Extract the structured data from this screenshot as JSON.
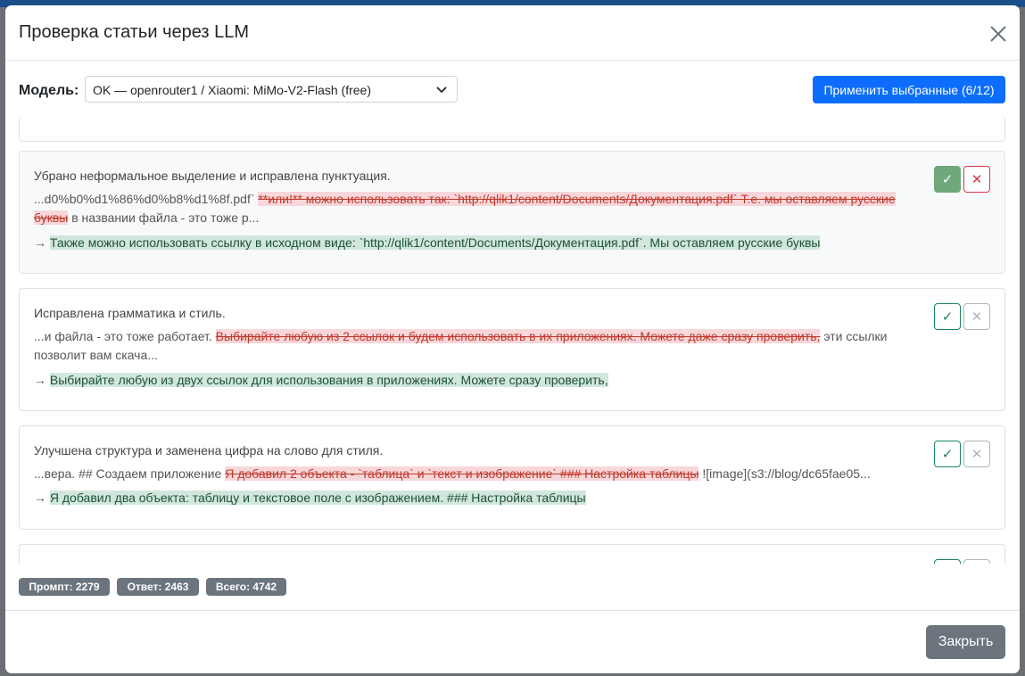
{
  "modal": {
    "title": "Проверка статьи через LLM",
    "model_label": "Модель:",
    "model_value": "OK — openrouter1 / Xiaomi: MiMo-V2-Flash (free)",
    "apply_label": "Применить выбранные (6/12)"
  },
  "suggestions": [
    {
      "title": "Убрано неформальное выделение и исправлена пунктуация.",
      "context_before": "...d0%b0%d1%86%d0%b8%d1%8f.pdf` ",
      "deleted": "**или!** можно использовать так: `http://qlik1/content/Documents/Документация.pdf` Т.е. мы оставляем русские буквы",
      "context_after": " в названии файла - это тоже р...",
      "arrow": "→ ",
      "inserted": "Также можно использовать ссылку в исходном виде: `http://qlik1/content/Documents/Документация.pdf`. Мы оставляем русские буквы",
      "accept_icon": "✓",
      "reject_icon": "✕",
      "state": "accepted"
    },
    {
      "title": "Исправлена грамматика и стиль.",
      "context_before": "...и файла - это тоже работает. ",
      "deleted": "Выбирайте любую из 2 ссылок и будем использовать в их приложениях. Можете даже сразу проверить,",
      "context_after": " эти ссылки позволит вам скача...",
      "arrow": "→ ",
      "inserted": "Выбирайте любую из двух ссылок для использования в приложениях. Можете сразу проверить,",
      "accept_icon": "✓",
      "reject_icon": "✕",
      "state": "none"
    },
    {
      "title": "Улучшена структура и заменена цифра на слово для стиля.",
      "context_before": "...вера. ## Создаем приложение ",
      "deleted": "Я добавил 2 объекта - `таблица` и `текст и изображение` ### Настройка таблицы",
      "context_after": " ![image](s3://blog/dc65fae05...",
      "arrow": "→ ",
      "inserted": "Я добавил два объекта: таблицу и текстовое поле с изображением. ### Настройка таблицы",
      "accept_icon": "✓",
      "reject_icon": "✕",
      "state": "none"
    }
  ],
  "tokens": {
    "prompt": "Промпт: 2279",
    "answer": "Ответ: 2463",
    "total": "Всего: 4742"
  },
  "footer": {
    "close_label": "Закрыть"
  },
  "colors": {
    "primary": "#0d6efd",
    "success": "#198754",
    "danger": "#dc3545",
    "secondary": "#6c757d",
    "deleted_bg": "#f8d7da",
    "inserted_bg": "#d1e7dd"
  }
}
